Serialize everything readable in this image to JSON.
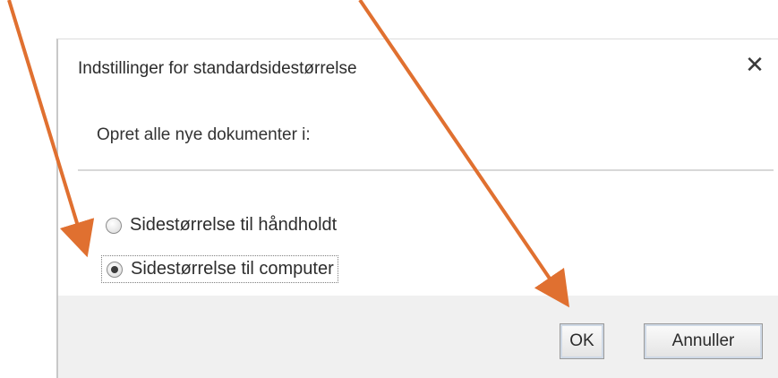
{
  "dialog": {
    "title": "Indstillinger for standardsidestørrelse",
    "close_icon": "close-icon",
    "prompt": "Opret alle nye dokumenter i:",
    "options": [
      {
        "label": "Sidestørrelse til håndholdt",
        "selected": false
      },
      {
        "label": "Sidestørrelse til computer",
        "selected": true
      }
    ],
    "buttons": {
      "ok_label": "OK",
      "cancel_label": "Annuller"
    }
  },
  "annotation": {
    "arrow_color": "#e07030",
    "arrow_count": 2
  },
  "colors": {
    "footer_bg": "#f0f0f0",
    "text": "#2b2b2b"
  }
}
